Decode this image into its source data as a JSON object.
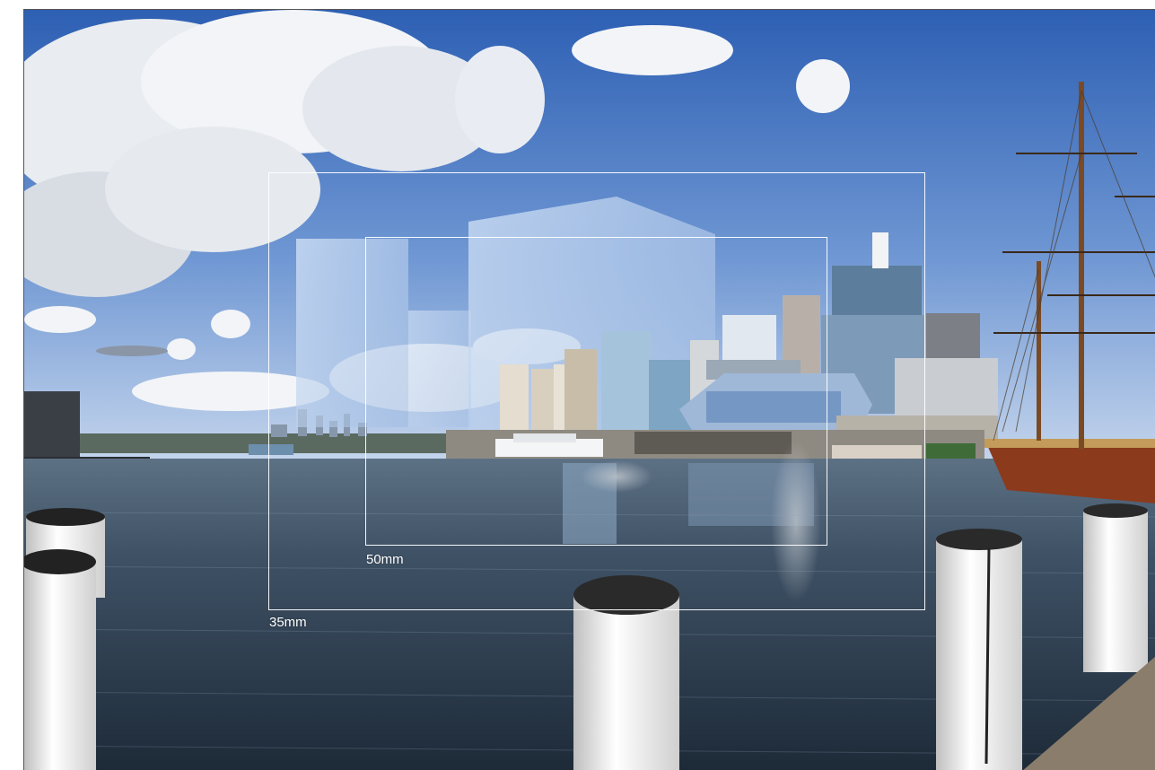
{
  "frames": [
    {
      "id": "35mm",
      "label": "35mm"
    },
    {
      "id": "50mm",
      "label": "50mm"
    }
  ],
  "colors": {
    "sky_top": "#2f63b8",
    "sky_bottom": "#b9cdea",
    "water_top": "#4d6073",
    "water_bottom": "#1f2c3b",
    "frame_outline": "#ffffff",
    "ship_hull": "#8b3a1c"
  }
}
